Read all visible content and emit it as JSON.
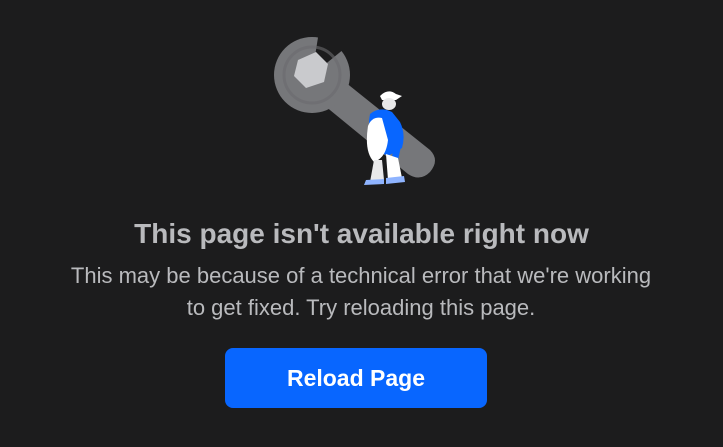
{
  "error": {
    "title": "This page isn't available right now",
    "message_line_1": "This may be because of a technical error that we're working",
    "message_line_2": "to get fixed. Try reloading this page.",
    "illustration": "wrench-with-worker-icon"
  },
  "actions": {
    "reload_label": "Reload Page"
  },
  "colors": {
    "background": "#1c1c1d",
    "text": "#b9babd",
    "button": "#0866ff",
    "button_text": "#ffffff",
    "wrench": "#76777a",
    "worker_blue": "#0866ff",
    "worker_light": "#ffffff"
  }
}
